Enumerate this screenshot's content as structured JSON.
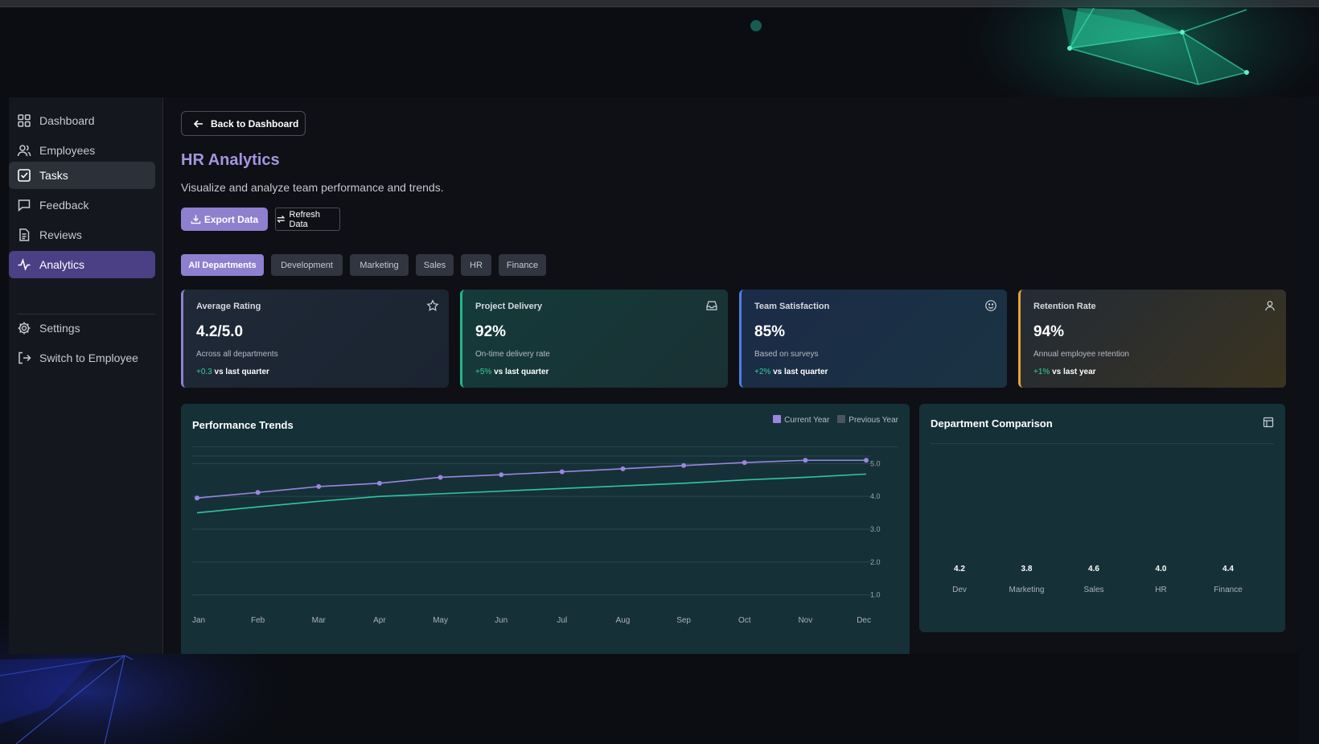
{
  "colors": {
    "accent": "#8f7fcf",
    "accent_dark": "#4b3f86",
    "title": "#a694e0",
    "positive": "#2fd39a",
    "current_series": "#9a86e0",
    "previous_series": "#2fc7a0",
    "previous_legend": "#4a5560"
  },
  "sidebar": {
    "items": [
      {
        "label": "Dashboard",
        "icon": "dashboard-grid-icon"
      },
      {
        "label": "Employees",
        "icon": "users-icon"
      },
      {
        "label": "Tasks",
        "icon": "checkbox-icon"
      },
      {
        "label": "Feedback",
        "icon": "message-square-icon"
      },
      {
        "label": "Reviews",
        "icon": "document-icon"
      },
      {
        "label": "Analytics",
        "icon": "activity-icon"
      }
    ],
    "bottom_items": [
      {
        "label": "Settings",
        "icon": "gear-icon"
      },
      {
        "label": "Switch to Employee",
        "icon": "logout-icon"
      }
    ]
  },
  "header": {
    "back_label": "Back to Dashboard",
    "title": "HR Analytics",
    "subtitle": "Visualize and analyze team performance and trends.",
    "export_label": "Export Data",
    "refresh_label": "Refresh Data"
  },
  "filters": [
    "All Departments",
    "Development",
    "Marketing",
    "Sales",
    "HR",
    "Finance"
  ],
  "cards": [
    {
      "label": "Average Rating",
      "value": "4.2/5.0",
      "desc": "Across all departments",
      "delta": "+0.3",
      "delta_suffix": "vs last quarter",
      "icon": "star-icon"
    },
    {
      "label": "Project Delivery",
      "value": "92%",
      "desc": "On-time delivery rate",
      "delta": "+5%",
      "delta_suffix": "vs last quarter",
      "icon": "inbox-icon"
    },
    {
      "label": "Team Satisfaction",
      "value": "85%",
      "desc": "Based on surveys",
      "delta": "+2%",
      "delta_suffix": "vs last quarter",
      "icon": "smile-icon"
    },
    {
      "label": "Retention Rate",
      "value": "94%",
      "desc": "Annual employee retention",
      "delta": "+1%",
      "delta_suffix": "vs last year",
      "icon": "user-icon"
    }
  ],
  "performance": {
    "title": "Performance Trends",
    "legend_current": "Current Year",
    "legend_previous": "Previous Year"
  },
  "department": {
    "title": "Department Comparison"
  },
  "chart_data": [
    {
      "type": "line",
      "title": "Performance Trends",
      "x": [
        "Jan",
        "Feb",
        "Mar",
        "Apr",
        "May",
        "Jun",
        "Jul",
        "Aug",
        "Sep",
        "Oct",
        "Nov",
        "Dec"
      ],
      "y_ticks": [
        "1.0",
        "2.0",
        "3.0",
        "4.0",
        "5.0"
      ],
      "ylim": [
        0.5,
        5.4
      ],
      "grid": true,
      "legend": "top-right",
      "series": [
        {
          "name": "Current Year",
          "values": [
            3.95,
            4.12,
            4.3,
            4.4,
            4.58,
            4.66,
            4.75,
            4.84,
            4.94,
            5.03,
            5.1,
            5.1
          ],
          "markers": true
        },
        {
          "name": "Previous Year",
          "values": [
            3.5,
            3.68,
            3.85,
            4.0,
            4.08,
            4.16,
            4.24,
            4.32,
            4.4,
            4.5,
            4.58,
            4.68
          ],
          "markers": false
        }
      ]
    },
    {
      "type": "bar",
      "title": "Department Comparison",
      "categories": [
        "Dev",
        "Marketing",
        "Sales",
        "HR",
        "Finance"
      ],
      "values": [
        4.2,
        3.8,
        4.6,
        4.0,
        4.4
      ]
    }
  ]
}
